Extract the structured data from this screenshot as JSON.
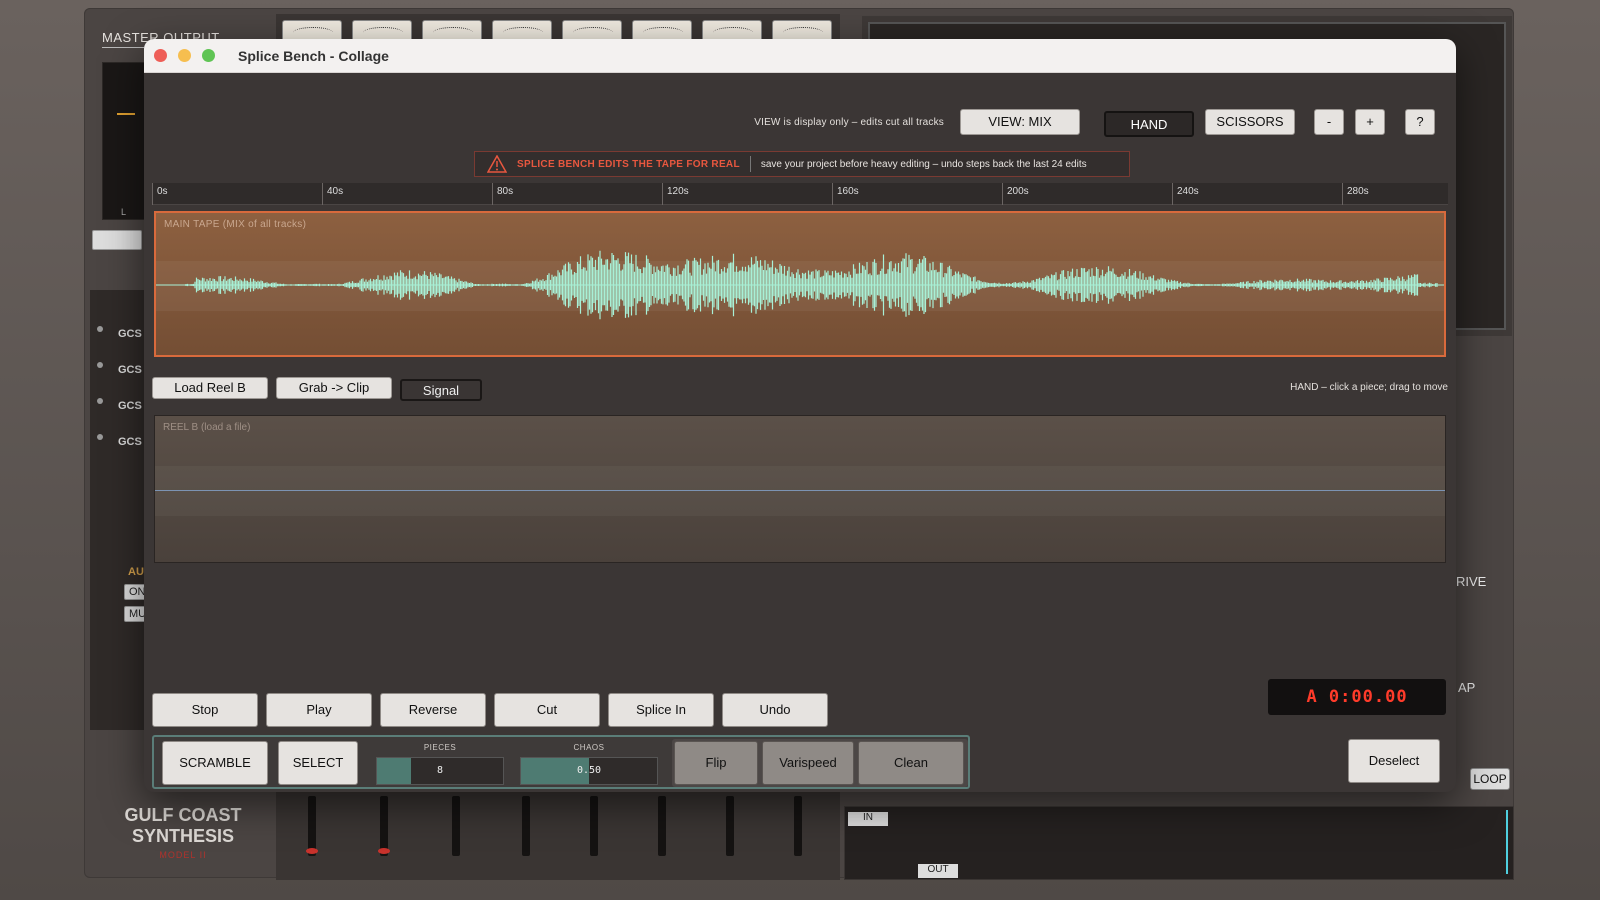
{
  "background": {
    "master_label": "MASTER OUTPUT",
    "meter_channel": "L",
    "channels": [
      "GCS I",
      "GCS M",
      "GCS",
      "GCS A"
    ],
    "au_label": "AU",
    "btn_on": "ON",
    "btn_mu": "MU",
    "brand_line1": "GULF COAST",
    "brand_line2": "SYNTHESIS",
    "brand_model": "MODEL II",
    "knob_drive": "RIVE",
    "knob_cap": "AP",
    "in_label": "IN",
    "out_label": "OUT",
    "loop_label": "LOOP"
  },
  "window": {
    "title": "Splice Bench - Collage"
  },
  "toolbar": {
    "view_note": "VIEW is display only – edits cut all tracks",
    "view_mix": "VIEW: MIX",
    "hand": "HAND",
    "scissors": "SCISSORS",
    "zoom_out": "-",
    "zoom_in": "+",
    "help": "?"
  },
  "warning": {
    "title": "SPLICE BENCH EDITS THE TAPE FOR REAL",
    "message": "save your project before heavy editing  –  undo steps back the last 24 edits"
  },
  "ruler": {
    "ticks": [
      "0s",
      "40s",
      "80s",
      "120s",
      "160s",
      "200s",
      "240s",
      "280s"
    ]
  },
  "main_tape": {
    "label": "MAIN TAPE  (MIX of all tracks)",
    "wave_color": "#a8f0d6"
  },
  "reel_bar": {
    "load_reel_b": "Load Reel B",
    "grab_clip": "Grab -> Clip",
    "signal": "Signal",
    "hand_note": "HAND  –  click a piece; drag to move"
  },
  "reel_b": {
    "label": "REEL B  (load a file)"
  },
  "transport": {
    "stop": "Stop",
    "play": "Play",
    "reverse": "Reverse",
    "cut": "Cut",
    "splice_in": "Splice In",
    "undo": "Undo"
  },
  "clock": {
    "value": "A 0:00.00"
  },
  "scramble": {
    "scramble": "SCRAMBLE",
    "select": "SELECT",
    "pieces_label": "PIECES",
    "pieces_value": "8",
    "pieces_fill": 0.27,
    "chaos_label": "CHAOS",
    "chaos_value": "0.50",
    "chaos_fill": 0.5,
    "flip": "Flip",
    "varispeed": "Varispeed",
    "clean": "Clean"
  },
  "deselect": "Deselect"
}
